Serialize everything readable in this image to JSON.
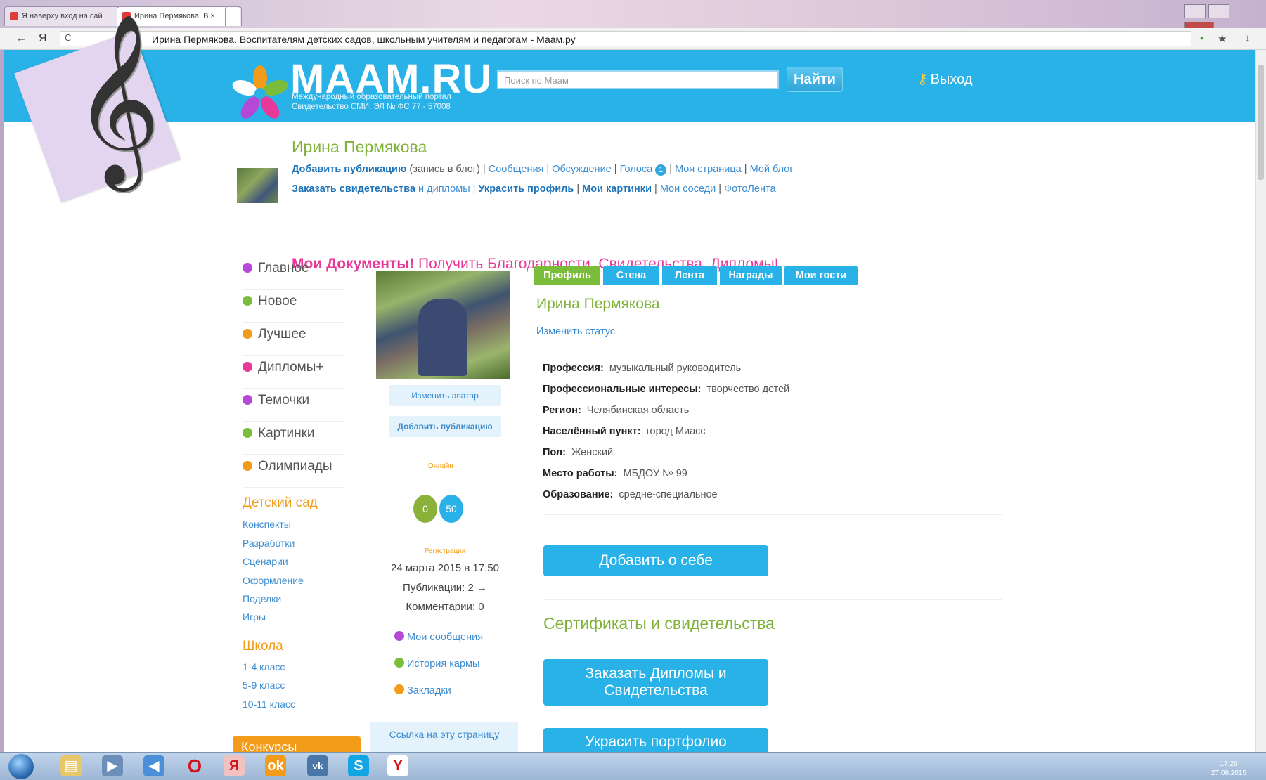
{
  "browser": {
    "tabs": [
      {
        "label": "Я наверху вход на сай",
        "active": false
      },
      {
        "label": "Ирина Пермякова. В ×",
        "active": true
      }
    ],
    "url": "Ирина Пермякова. Воспитателям детских садов, школьным учителям и педагогам - Маам.ру",
    "back_icon": "←",
    "y_icon": "Я",
    "reload_icon": "C"
  },
  "header": {
    "logo": "MAAM.RU",
    "logo_sub_1": "Международный образовательный портал",
    "logo_sub_2": "Свидетельство СМИ: ЭЛ № ФС 77 - 57008",
    "search_placeholder": "Поиск по Маам",
    "search_button": "Найти",
    "logout": "Выход"
  },
  "user": {
    "name": "Ирина Пермякова",
    "line1": {
      "add_pub": "Добавить публикацию",
      "add_pub_note": " (запись в блог) | ",
      "messages": "Сообщения",
      "discussion": "Обсуждение",
      "votes": "Голоса",
      "votes_count": "1",
      "my_page": "Моя страница",
      "my_blog": "Мой блог"
    },
    "line2": {
      "order": "Заказать свидетельства",
      "diplomas": " и дипломы | ",
      "decorate": "Украсить профиль",
      "pictures": "Мои картинки",
      "neighbors": "Мои соседи",
      "photo": "ФотоЛента"
    },
    "docs_bold": "Мои Документы!",
    "docs_rest": " Получить Благодарности, Свидетельства, Дипломы!"
  },
  "menu": {
    "items": [
      {
        "label": "Главное",
        "color": "#b548d6"
      },
      {
        "label": "Новое",
        "color": "#7bbd3a"
      },
      {
        "label": "Лучшее",
        "color": "#f39c19"
      },
      {
        "label": "Дипломы+",
        "color": "#e8399b"
      },
      {
        "label": "Темочки",
        "color": "#b548d6"
      },
      {
        "label": "Картинки",
        "color": "#7bbd3a"
      },
      {
        "label": "Олимпиады",
        "color": "#f39c19"
      }
    ],
    "kindergarten": {
      "title": "Детский сад",
      "links": [
        "Конспекты",
        "Разработки",
        "Сценарии",
        "Оформление",
        "Поделки",
        "Игры"
      ]
    },
    "school": {
      "title": "Школа",
      "links": [
        "1-4 класс",
        "5-9 класс",
        "10-11 класс"
      ]
    },
    "contests": "Конкурсы"
  },
  "middle": {
    "change_avatar": "Изменить аватар",
    "add_publication": "Добавить публикацию",
    "online": "Онлайн",
    "counter_green": "0",
    "counter_blue": "50",
    "registration_label": "Регистрация",
    "registration_date": "24 марта 2015 в 17:50",
    "publications": "Публикации: 2 →",
    "comments": "Комментарии: 0",
    "links": [
      {
        "label": "Мои сообщения",
        "color": "#b548d6"
      },
      {
        "label": "История кармы",
        "color": "#7bbd3a"
      },
      {
        "label": "Закладки",
        "color": "#f39c19"
      }
    ],
    "page_link": "Ссылка на эту страницу"
  },
  "profile": {
    "tabs": [
      "Профиль",
      "Стена",
      "Лента",
      "Награды",
      "Мои гости"
    ],
    "name": "Ирина Пермякова",
    "change_status": "Изменить статус",
    "fields": [
      {
        "label": "Профессия:",
        "value": "музыкальный руководитель"
      },
      {
        "label": "Профессиональные интересы:",
        "value": "творчество детей"
      },
      {
        "label": "Регион:",
        "value": "Челябинская область"
      },
      {
        "label": "Населённый пункт:",
        "value": "город Миасс"
      },
      {
        "label": "Пол:",
        "value": "Женский"
      },
      {
        "label": "Место работы:",
        "value": "МБДОУ № 99"
      },
      {
        "label": "Образование:",
        "value": "средне-специальное"
      }
    ],
    "about_button": "Добавить о себе",
    "certs_title": "Сертификаты и свидетельства",
    "order_button_1": "Заказать Дипломы и",
    "order_button_2": "Свидетельства",
    "portfolio_button": "Украсить портфолио"
  },
  "taskbar": {
    "icons": [
      "explorer-icon",
      "media-icon",
      "volume-icon",
      "opera-icon",
      "yandex-icon",
      "odnoklassniki-icon",
      "vk-icon",
      "skype-icon",
      "yandex-browser-icon"
    ],
    "time": "17:26",
    "date": "27.09.2015"
  }
}
